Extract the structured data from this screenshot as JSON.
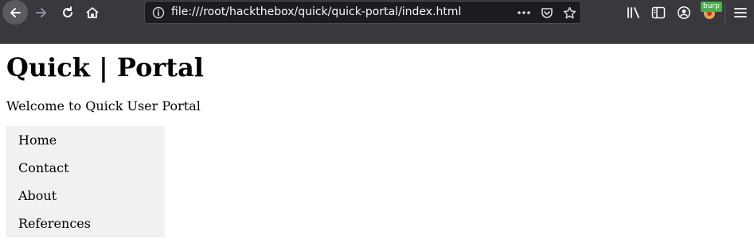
{
  "browser": {
    "url": "file:///root/hackthebox/quick/quick-portal/index.html",
    "extension_badge": "burp",
    "icons": {
      "back": "back-arrow-icon",
      "forward": "forward-arrow-icon",
      "reload": "reload-icon",
      "home": "home-icon",
      "info": "info-icon",
      "more": "more-dots-icon",
      "pocket": "pocket-icon",
      "bookmark": "star-icon",
      "library": "library-icon",
      "sidebar": "sidebar-icon",
      "account": "account-icon",
      "menu": "hamburger-menu-icon"
    },
    "colors": {
      "toolbar_bg": "#38383d",
      "urlbar_bg": "#1c1b22",
      "badge_bg": "#4caf50"
    }
  },
  "page": {
    "title": "Quick | Portal",
    "welcome": "Welcome to Quick User Portal",
    "nav_bg": "#f1f1f1",
    "nav": [
      {
        "label": "Home"
      },
      {
        "label": "Contact"
      },
      {
        "label": "About"
      },
      {
        "label": "References"
      }
    ]
  }
}
